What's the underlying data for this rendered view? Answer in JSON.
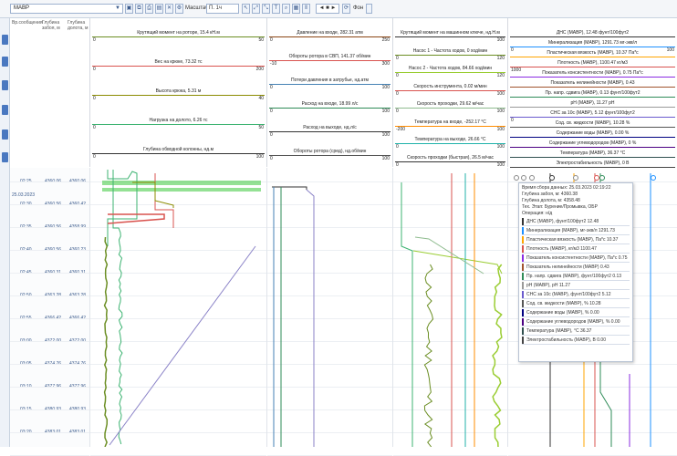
{
  "toolbar": {
    "well_name": "МАВР",
    "scale_label": "Масштаб",
    "scale_value": "П. 1ч",
    "nav_value": "◄ ■ ►",
    "format_label": "Фон"
  },
  "columns": {
    "time_header": "Вр.сообщения",
    "depth_header": "Глубина забоя, м",
    "bit_depth_header": "Глубина долота, м"
  },
  "track1": [
    {
      "name": "Крутящий момент на роторе, 15.4 кН.м",
      "min": "0",
      "max": "50",
      "color": "#6b8e23"
    },
    {
      "name": "Вес на крюке, 73.32 тс",
      "min": "0",
      "max": "200",
      "color": "#d9534f"
    },
    {
      "name": "Высота крюка, 5.31 м",
      "min": "0",
      "max": "40",
      "color": "#8b8b00"
    },
    {
      "name": "Нагрузка на долото, 6.26 тс",
      "min": "0",
      "max": "50",
      "color": "#3cb371"
    },
    {
      "name": "Глубина обводной колонны, нд.м",
      "min": "0",
      "max": "100",
      "color": "#333333"
    }
  ],
  "track2": [
    {
      "name": "Давление на входе, 282.31 атм",
      "min": "0",
      "max": "250",
      "color": "#8b4513"
    },
    {
      "name": "Обороты ротора в СВП, 141.37 об/мин",
      "min": "-10",
      "max": "300",
      "color": "#d9534f"
    },
    {
      "name": "Потери давления в затрубье, нд.атм",
      "min": "0",
      "max": "100",
      "color": "#4682b4"
    },
    {
      "name": "Расход на входе, 18.99 л/с",
      "min": "0",
      "max": "100",
      "color": "#2e8b57"
    },
    {
      "name": "Расход на выходе, нд.л/с",
      "min": "0",
      "max": "100",
      "color": "#333333"
    },
    {
      "name": "Обороты ротора (сред), нд.об/мин",
      "min": "0",
      "max": "100",
      "color": "#555555"
    }
  ],
  "track3": [
    {
      "name": "Крутящий момент на машинном ключе, нд.Н.м",
      "min": "",
      "max": "100",
      "color": "#333333"
    },
    {
      "name": "Насос 1 - Частота ходов, 0 ход/мин",
      "min": "0",
      "max": "120",
      "color": "#6b8e23"
    },
    {
      "name": "Насос 2 - Частота ходов, 84.66 ход/мин",
      "min": "0",
      "max": "120",
      "color": "#9acd32"
    },
    {
      "name": "Скорость инструмента, 0.02 м/мин",
      "min": "0",
      "max": "100",
      "color": "#d9534f"
    },
    {
      "name": "Скорость проходки, 29.62 м/час",
      "min": "0",
      "max": "100",
      "color": "#8fbc8f"
    },
    {
      "name": "Температура на входе, -252.17 °С",
      "min": "-200",
      "max": "100",
      "color": "#ff8c00"
    },
    {
      "name": "Температура на выходе, 26.66 °С",
      "min": "0",
      "max": "100",
      "color": "#20b2aa"
    },
    {
      "name": "Скорость проходки (быстрая), 26.5 м/час",
      "min": "0",
      "max": "100",
      "color": "#333333"
    }
  ],
  "track4": [
    {
      "name": "ДНС (МАВР), 12.48 фунт/100фут2",
      "min": "",
      "max": "",
      "color": "#333333"
    },
    {
      "name": "Минерализация (МАВР), 1291.73 мг-экв/л",
      "min": "0",
      "max": "100",
      "color": "#1e90ff"
    },
    {
      "name": "Пластическая вязкость (МАВР), 10.37 Па*с",
      "min": "",
      "max": "",
      "color": "#ffa500"
    },
    {
      "name": "Плотность (МАВР), 1100.47 кг/м3",
      "min": "1000",
      "max": "",
      "color": "#d9534f"
    },
    {
      "name": "Показатель консистентности (МАВР), 0.75 Па*с",
      "min": "",
      "max": "",
      "color": "#8a2be2"
    },
    {
      "name": "Показатель нелинейности (МАВР), 0.43",
      "min": "",
      "max": "",
      "color": "#a0522d"
    },
    {
      "name": "Пр. напр. сдвига (МАВР), 0.13 фунт/100фут2",
      "min": "",
      "max": "",
      "color": "#2e8b57"
    },
    {
      "name": "pH (МАВР), 11.27 рН",
      "min": "",
      "max": "",
      "color": "#999999"
    },
    {
      "name": "СНС за 10с (МАВР), 5.12 фунт/100фут2",
      "min": "0",
      "max": "",
      "color": "#6a5acd"
    },
    {
      "name": "Сод. св. жидкости (МАВР), 10.28 %",
      "min": "",
      "max": "",
      "color": "#555555"
    },
    {
      "name": "Содержание воды (МАВР), 0.00 %",
      "min": "",
      "max": "",
      "color": "#000080"
    },
    {
      "name": "Содержание углеводородов (МАВР), 0 %",
      "min": "",
      "max": "",
      "color": "#4b0082"
    },
    {
      "name": "Температура (МАВР), 36.37 °С",
      "min": "",
      "max": "",
      "color": "#2f4f4f"
    },
    {
      "name": "Электростабильность (МАВР), 0 В",
      "min": "",
      "max": "",
      "color": "#444444"
    }
  ],
  "rows": [
    {
      "time": "02:25",
      "depth": "4360.06",
      "bit": "4360.06"
    },
    {
      "time": "02:30",
      "depth": "4360.56",
      "bit": "4360.42"
    },
    {
      "time": "02:35",
      "depth": "4360.56",
      "bit": "4358.99"
    },
    {
      "time": "02:40",
      "depth": "4360.56",
      "bit": "4360.23"
    },
    {
      "time": "02:45",
      "depth": "4360.31",
      "bit": "4360.31"
    },
    {
      "time": "02:50",
      "depth": "4363.28",
      "bit": "4363.28"
    },
    {
      "time": "02:55",
      "depth": "4366.42",
      "bit": "4366.42"
    },
    {
      "time": "03:00",
      "depth": "4372.00",
      "bit": "4372.00"
    },
    {
      "time": "03:05",
      "depth": "4374.76",
      "bit": "4374.76"
    },
    {
      "time": "03:10",
      "depth": "4377.96",
      "bit": "4377.96"
    },
    {
      "time": "03:15",
      "depth": "4380.93",
      "bit": "4380.93"
    },
    {
      "time": "03:20",
      "depth": "4383.01",
      "bit": "4383.01"
    }
  ],
  "date_label": "25.03.2023",
  "tooltip": {
    "header": [
      "Время сбора данных: 25.03.2023 02:19:22",
      "Глубина забоя, м: 4360.38",
      "Глубина долота, м: 4358.48",
      "Тех. Этап: Бурение/Промывка, ОБР",
      "Операция: н/д"
    ],
    "items": [
      {
        "text": "ДНС (МАВР), фунт/100фут2 12.48",
        "color": "#333333"
      },
      {
        "text": "Минерализация (МАВР), мг-экв/л 1291.73",
        "color": "#1e90ff"
      },
      {
        "text": "Пластическая вязкость (МАВР), Па*с 10.37",
        "color": "#ffa500"
      },
      {
        "text": "Плотность (МАВР), кг/м3 1100.47",
        "color": "#d9534f"
      },
      {
        "text": "Показатель консистентности (МАВР), Па*с 0.75",
        "color": "#8a2be2"
      },
      {
        "text": "Показатель нелинейности (МАВР) 0.43",
        "color": "#a0522d"
      },
      {
        "text": "Пр. напр. сдвига (МАВР), фунт/100фут2 0.13",
        "color": "#2e8b57"
      },
      {
        "text": "pH (МАВР), рН 11.27",
        "color": "#999999"
      },
      {
        "text": "СНС за 10с (МАВР), фунт/100фут2 5.12",
        "color": "#6a5acd"
      },
      {
        "text": "Сод. св. жидкости (МАВР), % 10.28",
        "color": "#555555"
      },
      {
        "text": "Содержание воды (МАВР), % 0.00",
        "color": "#000080"
      },
      {
        "text": "Содержание углеводородов (МАВР), % 0.00",
        "color": "#4b0082"
      },
      {
        "text": "Температура (МАВР), °С 36.37",
        "color": "#2f4f4f"
      },
      {
        "text": "Электростабильность (МАВР), В 0.00",
        "color": "#444444"
      }
    ]
  }
}
